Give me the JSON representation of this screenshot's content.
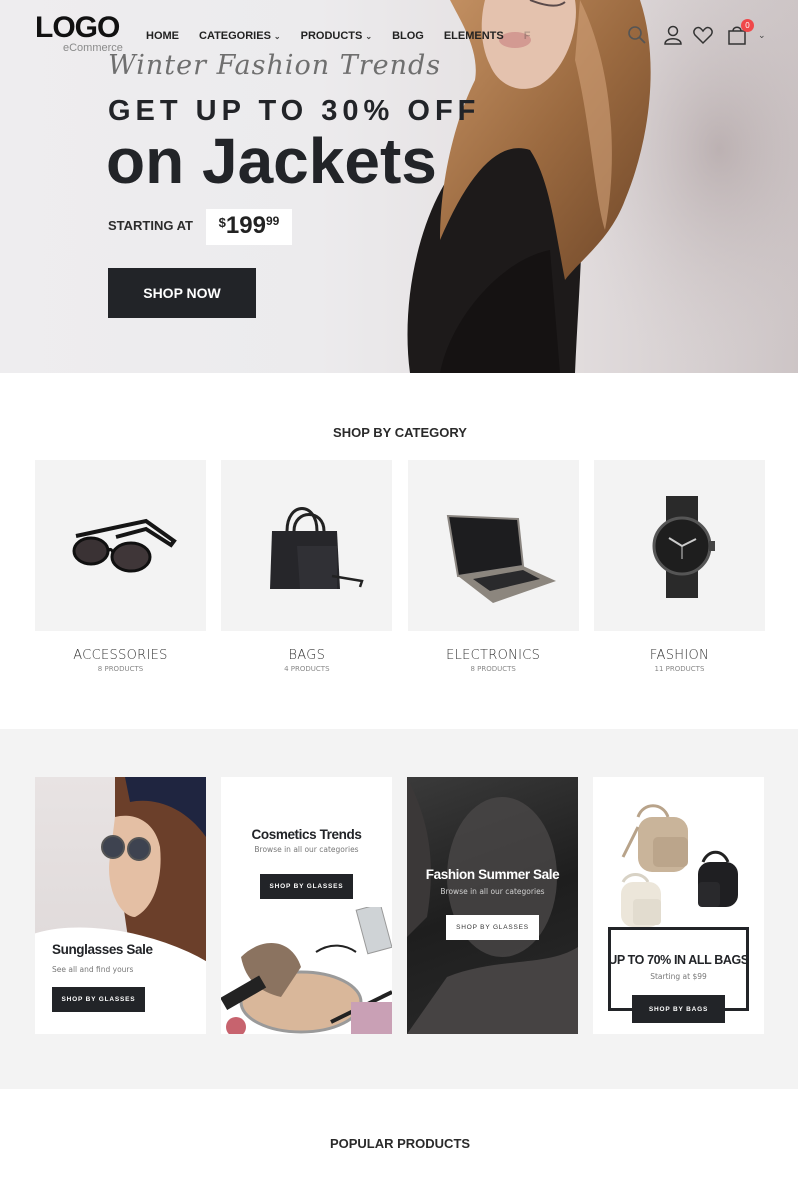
{
  "header": {
    "logo_main": "LOGO",
    "logo_sub": "eCommerce",
    "nav": [
      {
        "label": "HOME",
        "has_dropdown": false
      },
      {
        "label": "CATEGORIES",
        "has_dropdown": true
      },
      {
        "label": "PRODUCTS",
        "has_dropdown": true
      },
      {
        "label": "BLOG",
        "has_dropdown": false
      },
      {
        "label": "ELEMENTS",
        "has_dropdown": false
      },
      {
        "label": "F",
        "has_dropdown": false
      }
    ],
    "icons": [
      "search-icon",
      "user-icon",
      "heart-icon",
      "cart-icon"
    ],
    "cart_count": "0",
    "cart_badge_color": "#f0484a",
    "dropdown_glyph": "⌄"
  },
  "hero": {
    "script_text": "Winter Fashion Trends",
    "headline": "GET UP TO 30% OFF",
    "title": "on Jackets",
    "starting_label": "STARTING AT",
    "price_currency": "$",
    "price_main": "199",
    "price_cents": "99",
    "cta_label": "SHOP NOW"
  },
  "categories": {
    "title": "SHOP BY CATEGORY",
    "items": [
      {
        "name": "ACCESSORIES",
        "count": "8 PRODUCTS",
        "image": "sunglasses"
      },
      {
        "name": "BAGS",
        "count": "4 PRODUCTS",
        "image": "handbag"
      },
      {
        "name": "ELECTRONICS",
        "count": "8 PRODUCTS",
        "image": "laptop"
      },
      {
        "name": "FASHION",
        "count": "11 PRODUCTS",
        "image": "watch"
      }
    ]
  },
  "banners": [
    {
      "title": "Sunglasses Sale",
      "subtitle": "See all and find yours",
      "button": "SHOP BY GLASSES"
    },
    {
      "title": "Cosmetics Trends",
      "subtitle": "Browse in all our categories",
      "button": "SHOP BY GLASSES"
    },
    {
      "title": "Fashion Summer Sale",
      "subtitle": "Browse in all our categories",
      "button": "SHOP BY GLASSES"
    },
    {
      "title": "UP TO 70% IN ALL BAGS",
      "subtitle": "Starting at $99",
      "button": "SHOP BY BAGS"
    }
  ],
  "popular": {
    "title": "POPULAR PRODUCTS"
  },
  "colors": {
    "dark": "#222428",
    "light_bg": "#f3f3f3",
    "accent_badge": "#f0484a"
  }
}
